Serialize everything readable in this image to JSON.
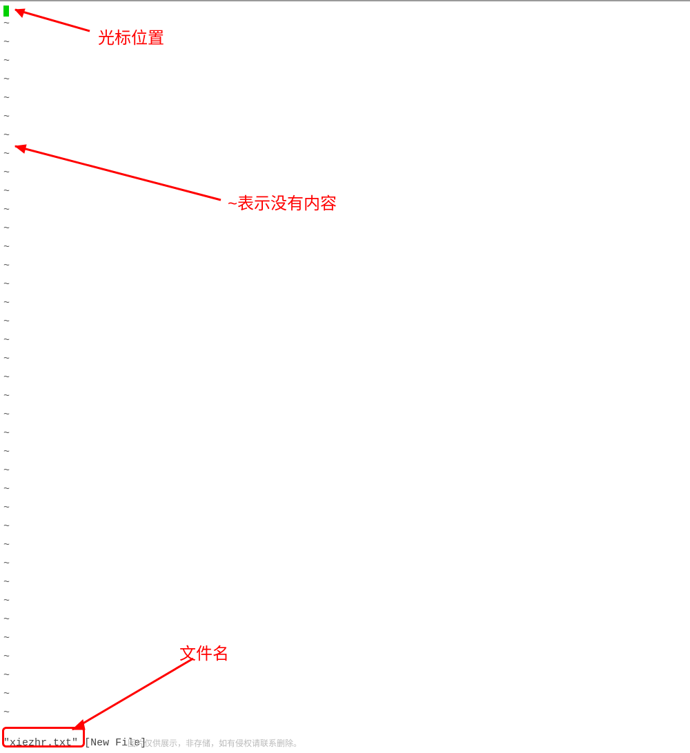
{
  "editor": {
    "tilde_char": "~",
    "tilde_lines": 38,
    "status": {
      "filename": "xiezhr.txt",
      "flag": "[New File]"
    }
  },
  "annotations": {
    "cursor_label": "光标位置",
    "tilde_label": "~表示没有内容",
    "filename_label": "文件名"
  },
  "watermark": "图片仅供展示，非存储，如有侵权请联系删除。",
  "colors": {
    "highlight": "#ff0000",
    "cursor": "#00d000"
  }
}
